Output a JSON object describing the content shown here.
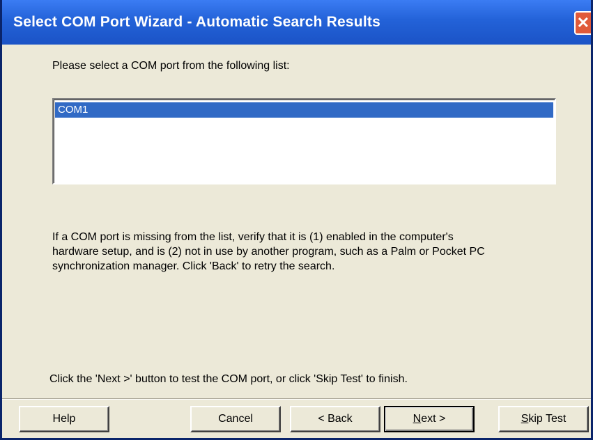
{
  "window": {
    "title": "Select COM Port Wizard - Automatic Search Results",
    "close_glyph": "✕"
  },
  "prompt": "Please select a COM port from the following list:",
  "ports": {
    "items": [
      "COM1"
    ],
    "selected": "COM1"
  },
  "info": {
    "line1": "If a COM port is missing from the list, verify that it is (1) enabled in the computer's",
    "line2": "hardware setup, and is (2) not in use by another program, such as a Palm or Pocket PC",
    "line3": "synchronization manager. Click 'Back' to retry the search."
  },
  "instruction": "Click the 'Next >' button to test the COM port, or click 'Skip Test' to finish.",
  "buttons": {
    "help": "Help",
    "cancel": "Cancel",
    "back": "< Back",
    "next_first": "N",
    "next_rest": "ext >",
    "skip_first": "S",
    "skip_rest": "kip Test"
  },
  "colors": {
    "titlebar": "#2362d8",
    "selection": "#316ac5",
    "face": "#ece9d8"
  }
}
